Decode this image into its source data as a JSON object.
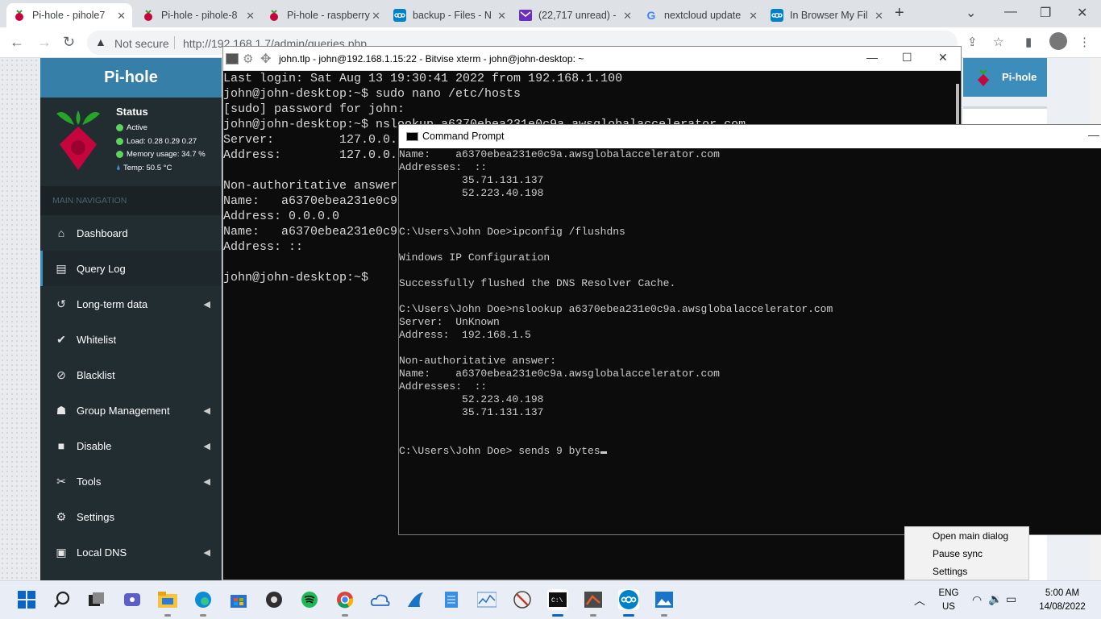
{
  "browser": {
    "tabs": [
      {
        "title": "Pi-hole - pihole7",
        "active": true,
        "favicon": "raspberry-icon"
      },
      {
        "title": "Pi-hole - pihole-8",
        "active": false,
        "favicon": "raspberry-icon"
      },
      {
        "title": "Pi-hole - raspberry",
        "active": false,
        "favicon": "raspberry-icon"
      },
      {
        "title": "backup - Files - N",
        "active": false,
        "favicon": "nextcloud-icon"
      },
      {
        "title": "(22,717 unread) -",
        "active": false,
        "favicon": "mail-icon"
      },
      {
        "title": "nextcloud update",
        "active": false,
        "favicon": "google-icon"
      },
      {
        "title": "In Browser My Fil",
        "active": false,
        "favicon": "nextcloud-icon"
      }
    ],
    "security_label": "Not secure",
    "url": "http://192.168.1.7/admin/queries.php"
  },
  "pihole": {
    "logo": "Pi-hole",
    "status_title": "Status",
    "status_active": "Active",
    "load": "Load:  0.28  0.29  0.27",
    "memory": "Memory usage:  34.7 %",
    "temp": "Temp: 50.5 °C",
    "nav_header": "MAIN NAVIGATION",
    "nav": [
      {
        "label": "Dashboard",
        "icon": "home-icon"
      },
      {
        "label": "Query Log",
        "icon": "file-icon",
        "active": true
      },
      {
        "label": "Long-term data",
        "icon": "history-icon",
        "expandable": true
      },
      {
        "label": "Whitelist",
        "icon": "check-circle-icon"
      },
      {
        "label": "Blacklist",
        "icon": "ban-icon"
      },
      {
        "label": "Group Management",
        "icon": "users-icon",
        "expandable": true
      },
      {
        "label": "Disable",
        "icon": "stop-icon",
        "expandable": true
      },
      {
        "label": "Tools",
        "icon": "tools-icon",
        "expandable": true
      },
      {
        "label": "Settings",
        "icon": "gear-icon"
      },
      {
        "label": "Local DNS",
        "icon": "address-book-icon",
        "expandable": true
      }
    ],
    "right_logo": "Pi-hole"
  },
  "xterm": {
    "title": "john.tlp - john@192.168.1.15:22 - Bitvise xterm - john@john-desktop: ~",
    "lines": [
      "Last login: Sat Aug 13 19:30:41 2022 from 192.168.1.100",
      "john@john-desktop:~$ sudo nano /etc/hosts",
      "[sudo] password for john:",
      "john@john-desktop:~$ nslookup a6370ebea231e0c9a.awsglobalaccelerator.com",
      "Server:         127.0.0.53",
      "Address:        127.0.0.53#53",
      "",
      "Non-authoritative answer:",
      "Name:   a6370ebea231e0c9a.awsglobalaccelerator.com",
      "Address: 0.0.0.0",
      "Name:   a6370ebea231e0c9a.awsglobalaccelerator.com",
      "Address: ::",
      "",
      "john@john-desktop:~$"
    ]
  },
  "cmd": {
    "title": "Command Prompt",
    "lines": [
      "Name:    a6370ebea231e0c9a.awsglobalaccelerator.com",
      "Addresses:  ::",
      "          35.71.131.137",
      "          52.223.40.198",
      "",
      "",
      "C:\\Users\\John Doe>ipconfig /flushdns",
      "",
      "Windows IP Configuration",
      "",
      "Successfully flushed the DNS Resolver Cache.",
      "",
      "C:\\Users\\John Doe>nslookup a6370ebea231e0c9a.awsglobalaccelerator.com",
      "Server:  UnKnown",
      "Address:  192.168.1.5",
      "",
      "Non-authoritative answer:",
      "Name:    a6370ebea231e0c9a.awsglobalaccelerator.com",
      "Addresses:  ::",
      "          52.223.40.198",
      "          35.71.131.137",
      "",
      "",
      "C:\\Users\\John Doe> sends 9 bytes"
    ]
  },
  "tray_menu": {
    "items": [
      "Open main dialog",
      "Pause sync",
      "Settings"
    ]
  },
  "taskbar": {
    "lang_top": "ENG",
    "lang_bottom": "US",
    "time": "5:00 AM",
    "date": "14/08/2022"
  }
}
